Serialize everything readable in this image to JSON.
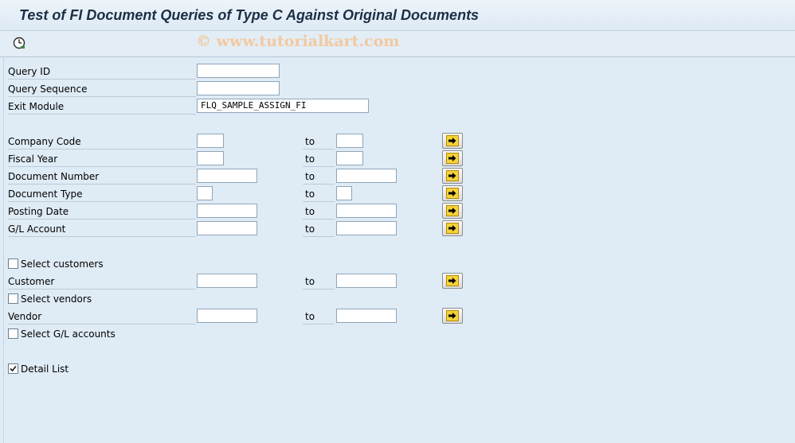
{
  "window": {
    "title": "Test of FI Document Queries of Type C Against Original Documents"
  },
  "toolbar": {
    "execute_icon": "execute-clock-icon",
    "watermark": "© www.tutorialkart.com"
  },
  "fields": {
    "query_id": {
      "label": "Query ID",
      "value": ""
    },
    "query_sequence": {
      "label": "Query Sequence",
      "value": ""
    },
    "exit_module": {
      "label": "Exit Module",
      "value": "FLQ_SAMPLE_ASSIGN_FI"
    }
  },
  "ranges": {
    "to_label": "to",
    "company_code": {
      "label": "Company Code",
      "from": "",
      "to": ""
    },
    "fiscal_year": {
      "label": "Fiscal Year",
      "from": "",
      "to": ""
    },
    "document_number": {
      "label": "Document Number",
      "from": "",
      "to": ""
    },
    "document_type": {
      "label": "Document Type",
      "from": "",
      "to": ""
    },
    "posting_date": {
      "label": "Posting Date",
      "from": "",
      "to": ""
    },
    "gl_account": {
      "label": "G/L Account",
      "from": "",
      "to": ""
    },
    "customer": {
      "label": "Customer",
      "from": "",
      "to": ""
    },
    "vendor": {
      "label": "Vendor",
      "from": "",
      "to": ""
    }
  },
  "checkboxes": {
    "select_customers": {
      "label": "Select customers",
      "checked": false
    },
    "select_vendors": {
      "label": "Select vendors",
      "checked": false
    },
    "select_gl_accounts": {
      "label": "Select G/L accounts",
      "checked": false
    },
    "detail_list": {
      "label": "Detail List",
      "checked": true
    }
  },
  "colors": {
    "background": "#dfebf5",
    "title": "#1b2f46",
    "arrow_button": "#f7d23a"
  }
}
